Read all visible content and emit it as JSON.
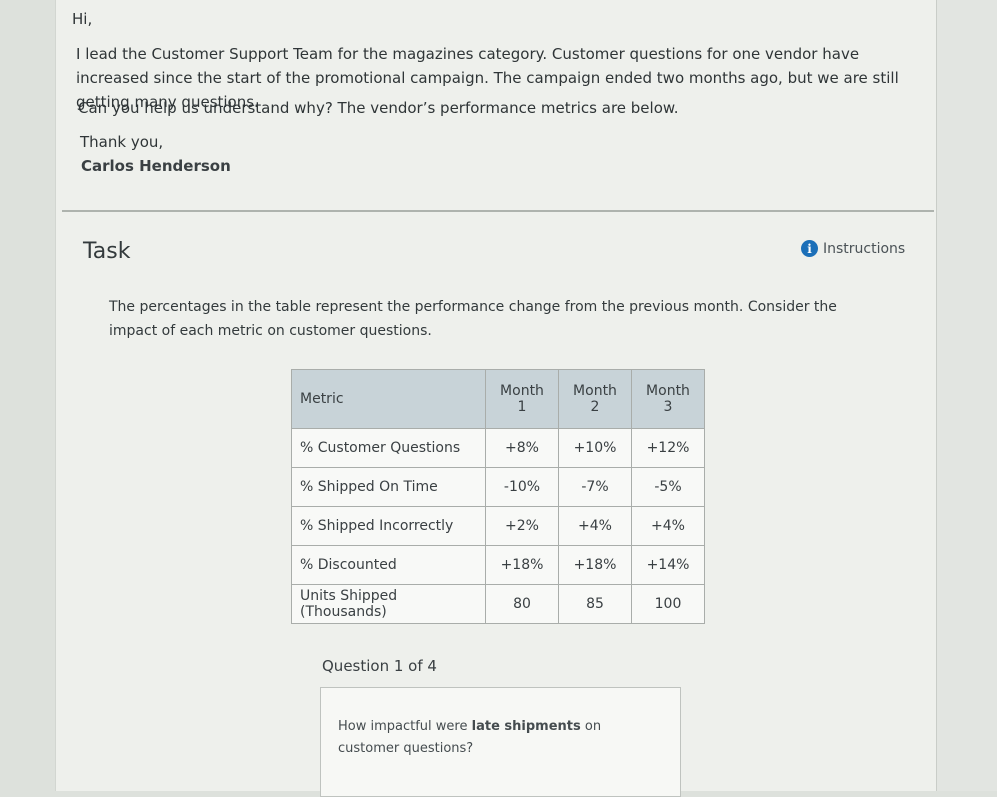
{
  "email": {
    "greeting": "Hi,",
    "body": "I lead the Customer Support Team for the magazines category. Customer questions for one vendor have increased since the start of the promotional campaign. The campaign ended two months ago, but we are still getting many questions.",
    "question": "Can you help us understand why? The vendor’s performance metrics are below.",
    "closing": "Thank you,",
    "signature": "Carlos Henderson"
  },
  "task": {
    "title": "Task",
    "instructions_label": "Instructions",
    "description": "The percentages in the table represent the performance change from the previous month. Consider the impact of each metric on customer questions."
  },
  "table": {
    "headers": [
      "Metric",
      "Month 1",
      "Month 2",
      "Month 3"
    ],
    "rows": [
      [
        "% Customer Questions",
        "+8%",
        "+10%",
        "+12%"
      ],
      [
        "% Shipped On Time",
        "-10%",
        "-7%",
        "-5%"
      ],
      [
        "% Shipped Incorrectly",
        "+2%",
        "+4%",
        "+4%"
      ],
      [
        "% Discounted",
        "+18%",
        "+18%",
        "+14%"
      ],
      [
        "Units Shipped (Thousands)",
        "80",
        "85",
        "100"
      ]
    ]
  },
  "question": {
    "counter": "Question 1 of 4",
    "prefix": "How impactful were ",
    "emphasis": "late shipments",
    "suffix": " on customer questions?"
  },
  "colors": {
    "header_bg": "#c8d3d8",
    "info_icon": "#1b6fb8"
  }
}
